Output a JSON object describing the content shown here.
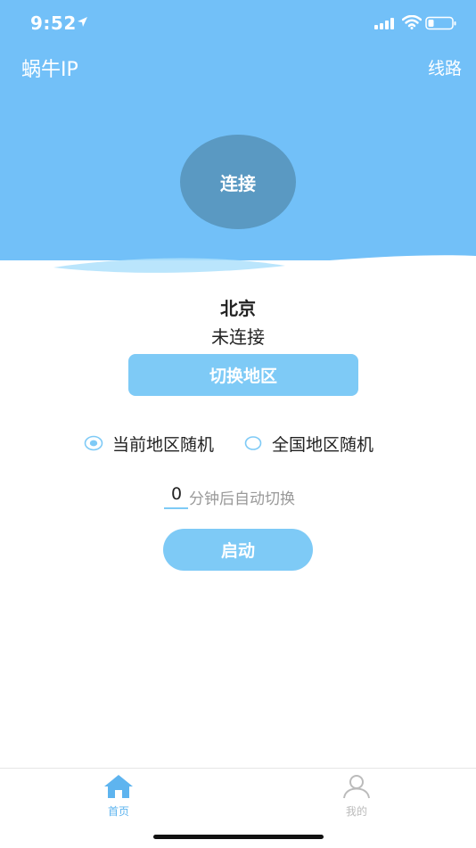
{
  "status_bar": {
    "time": "9:52"
  },
  "header": {
    "title": "蜗牛IP",
    "route_label": "线路"
  },
  "connect": {
    "label": "连接"
  },
  "location": {
    "city": "北京",
    "status": "未连接",
    "switch_label": "切换地区"
  },
  "mode_options": [
    {
      "label": "当前地区随机",
      "selected": true
    },
    {
      "label": "全国地区随机",
      "selected": false
    }
  ],
  "timer": {
    "value": "0",
    "label": "分钟后自动切换"
  },
  "start": {
    "label": "启动"
  },
  "tabs": [
    {
      "label": "首页",
      "icon": "home-icon",
      "active": true
    },
    {
      "label": "我的",
      "icon": "user-icon",
      "active": false
    }
  ],
  "colors": {
    "header_bg": "#72c0f8",
    "connect_circle": "#5a99c2",
    "accent": "#7ecaf6",
    "tab_active": "#5eb4ef",
    "tab_inactive": "#bbbbbb"
  }
}
